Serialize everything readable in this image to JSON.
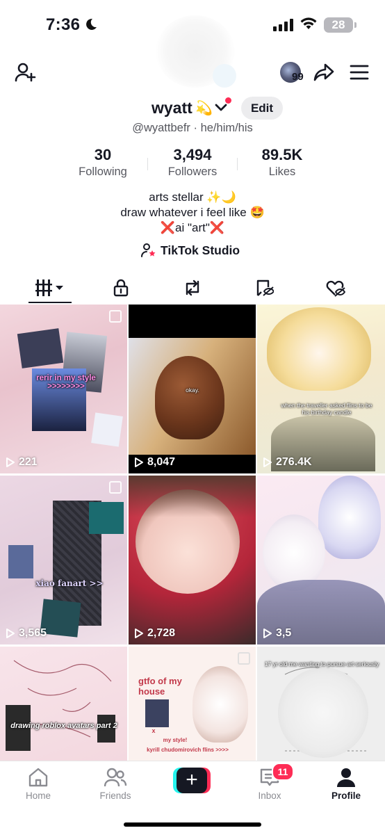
{
  "status_bar": {
    "time": "7:36",
    "battery": "28"
  },
  "header": {
    "story_count": "99"
  },
  "profile": {
    "username": "wyatt",
    "username_emoji": "💫",
    "edit_label": "Edit",
    "handle_line": "@wyattbefr · he/him/his",
    "stats": [
      {
        "value": "30",
        "label": "Following"
      },
      {
        "value": "3,494",
        "label": "Followers"
      },
      {
        "value": "89.5K",
        "label": "Likes"
      }
    ],
    "bio": [
      "arts stellar ✨🌙",
      "draw whatever i feel like 🤩",
      "❌ai \"art\"❌"
    ],
    "studio_label": "TikTok Studio"
  },
  "tabs": [
    "videos-icon",
    "lock-icon",
    "repost-icon",
    "favorites-icon",
    "liked-icon"
  ],
  "videos": [
    {
      "views": "221",
      "caption": "rerir in my style\n>>>>>>>>"
    },
    {
      "views": "8,047",
      "caption": "okay."
    },
    {
      "views": "276.4K",
      "caption": "when the traveller asked flins to be his birthday candle"
    },
    {
      "views": "3,565",
      "caption": "xiao fanart >>"
    },
    {
      "views": "2,728",
      "caption": ""
    },
    {
      "views": "3,5",
      "caption": ""
    },
    {
      "views": "",
      "caption": "drawing roblox avatars part 2"
    },
    {
      "views": "",
      "caption": "gtfo of my house"
    },
    {
      "views": "",
      "caption": "17 yr old me wanting to pursue art seriously"
    }
  ],
  "video_extra": {
    "text_x": "x",
    "text_mystyle": "my style!",
    "text_flins": "kyrill chudomirovich flins >>>>"
  },
  "tabbar": {
    "home": "Home",
    "friends": "Friends",
    "inbox": "Inbox",
    "inbox_badge": "11",
    "profile": "Profile"
  }
}
